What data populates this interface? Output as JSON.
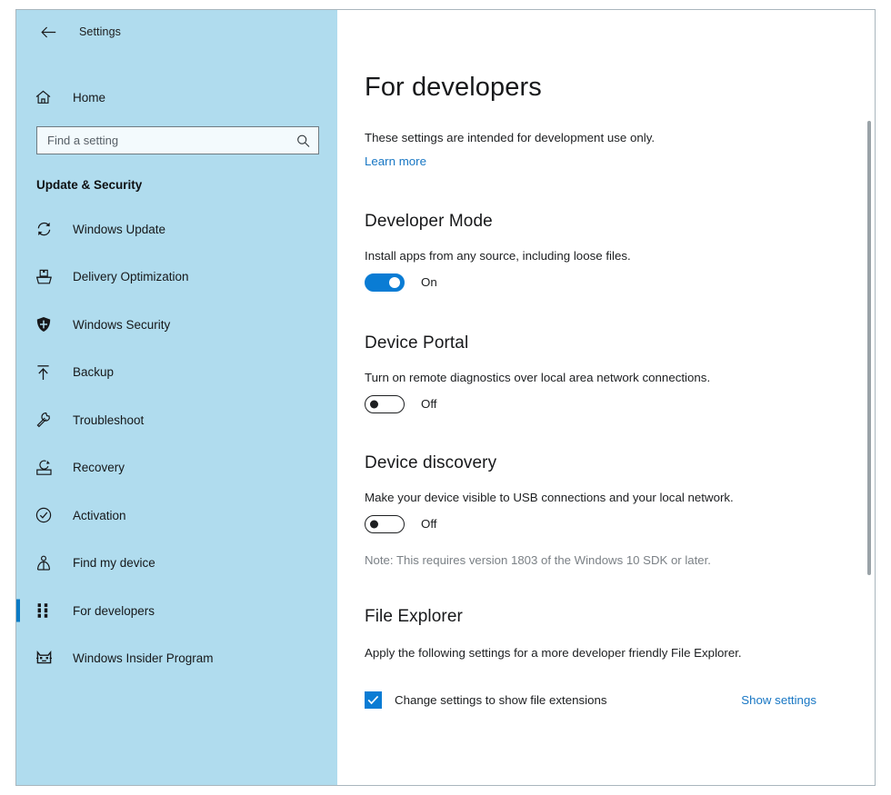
{
  "window": {
    "app_title": "Settings",
    "back_icon": "back-arrow-icon"
  },
  "sidebar": {
    "home": {
      "label": "Home",
      "icon": "home-icon"
    },
    "search": {
      "placeholder": "Find a setting",
      "value": "",
      "icon": "search-icon"
    },
    "section_title": "Update & Security",
    "items": [
      {
        "label": "Windows Update",
        "icon": "sync-refresh-icon",
        "selected": false
      },
      {
        "label": "Delivery Optimization",
        "icon": "delivery-package-icon",
        "selected": false
      },
      {
        "label": "Windows Security",
        "icon": "shield-icon",
        "selected": false
      },
      {
        "label": "Backup",
        "icon": "upload-arrow-icon",
        "selected": false
      },
      {
        "label": "Troubleshoot",
        "icon": "wrench-icon",
        "selected": false
      },
      {
        "label": "Recovery",
        "icon": "recovery-icon",
        "selected": false
      },
      {
        "label": "Activation",
        "icon": "check-circle-icon",
        "selected": false
      },
      {
        "label": "Find my device",
        "icon": "person-location-icon",
        "selected": false
      },
      {
        "label": "For developers",
        "icon": "developer-tools-icon",
        "selected": true
      },
      {
        "label": "Windows Insider Program",
        "icon": "ninjacat-icon",
        "selected": false
      }
    ]
  },
  "main": {
    "page_title": "For developers",
    "intro_text": "These settings are intended for development use only.",
    "learn_more_link": "Learn more",
    "sections": {
      "developer_mode": {
        "heading": "Developer Mode",
        "description": "Install apps from any source, including loose files.",
        "toggle_state": "On",
        "toggle_on": true
      },
      "device_portal": {
        "heading": "Device Portal",
        "description": "Turn on remote diagnostics over local area network connections.",
        "toggle_state": "Off",
        "toggle_on": false
      },
      "device_discovery": {
        "heading": "Device discovery",
        "description": "Make your device visible to USB connections and your local network.",
        "toggle_state": "Off",
        "toggle_on": false,
        "note": "Note: This requires version 1803 of the Windows 10 SDK or later."
      },
      "file_explorer": {
        "heading": "File Explorer",
        "description": "Apply the following settings for a more developer friendly File Explorer.",
        "checkbox_label": "Change settings to show file extensions",
        "checkbox_checked": true,
        "show_settings_link": "Show settings"
      }
    }
  },
  "colors": {
    "sidebar_background": "#b0dcee",
    "accent_blue": "#0a7cd4",
    "link_blue": "#1877c4",
    "selection_bar": "#0a7ac4",
    "note_gray": "#7b8186"
  }
}
